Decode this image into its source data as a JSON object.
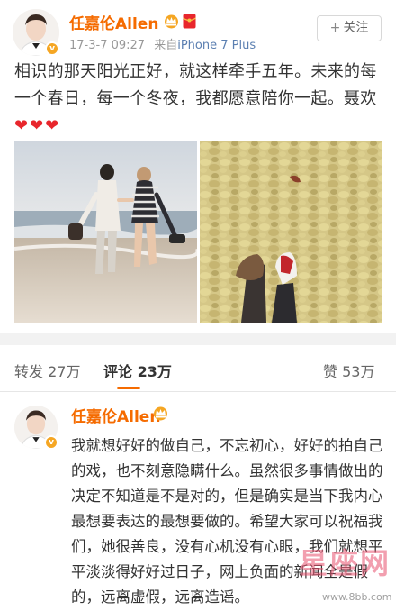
{
  "post": {
    "username": "任嘉伦Allen",
    "timestamp": "17-3-7 09:27",
    "source_prefix": "来自",
    "device": "iPhone 7 Plus",
    "follow_label": "关注",
    "follow_plus": "+",
    "text": "相识的那天阳光正好，就这样牵手五年。未来的每一个春日，每一个冬夜，我都愿意陪你一起。聂欢",
    "hearts": "❤❤❤",
    "verified_badge": "v",
    "icons": [
      "crown-icon",
      "hongbao-icon",
      "plus-icon"
    ],
    "photos": [
      "beach-couple-photo",
      "ginkgo-leaves-photo"
    ]
  },
  "tabs": [
    {
      "label": "转发 27万"
    },
    {
      "label": "评论 23万"
    },
    {
      "label": "赞 53万"
    }
  ],
  "comment": {
    "username": "任嘉伦Allen",
    "verified_badge": "v",
    "text": "我就想好好的做自己，不忘初心，好好的拍自己的戏，也不刻意隐瞒什么。虽然很多事情做出的决定不知道是不是对的，但是确实是当下我内心最想要表达的最想要做的。希望大家可以祝福我们，她很善良，没有心机没有心眼，我们就想平平淡淡得好好过日子，网上负面的新闻全是假的，远离虚假，远离造谣。"
  },
  "watermark": {
    "logo": "星座网",
    "url": "www.8bb.com"
  },
  "colors": {
    "accent": "#f56b00",
    "heart": "#e8262c",
    "device_link": "#5b7fb1",
    "badge": "#f5a623"
  }
}
